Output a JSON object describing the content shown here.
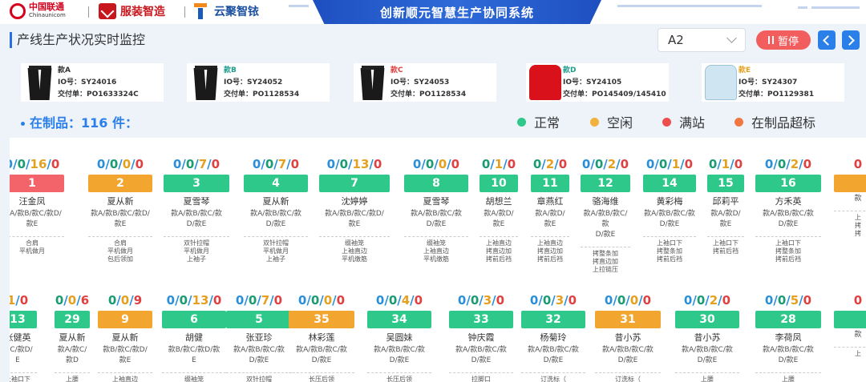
{
  "header": {
    "unicom_cn": "中国联通",
    "unicom_en": "Chinaunicom",
    "fz_name": "服装智造",
    "yj_name": "云聚智铱",
    "system_title": "创新顺元智慧生产协同系统"
  },
  "toolbar": {
    "page_title": "产线生产状况实时监控",
    "line_select_value": "A2",
    "pause_label": "暂停"
  },
  "styles": [
    {
      "name": "款A",
      "io": "IO号：SY24016",
      "order": "交付单：PO1633324C",
      "name_color": "#333333",
      "garment": "black-pants"
    },
    {
      "name": "款B",
      "io": "IO号：SY24052",
      "order": "交付单：PO1128534",
      "name_color": "#1f9c8c",
      "garment": "black-pants"
    },
    {
      "name": "款C",
      "io": "IO号：SY24053",
      "order": "交付单：PO1128534",
      "name_color": "#e04040",
      "garment": "black-pants"
    },
    {
      "name": "款D",
      "io": "IO号：SY24105",
      "order": "交付单：PO145409/145410",
      "name_color": "#1f9c8c",
      "garment": "red-hoodie"
    },
    {
      "name": "款E",
      "io": "IO号：SY24307",
      "order": "交付单：PO1129381",
      "name_color": "#e6a020",
      "garment": "blue-hoodie"
    }
  ],
  "wip_text": "在制品：116 件：",
  "legend": [
    {
      "label": "正常",
      "color": "#2ec88a"
    },
    {
      "label": "空闲",
      "color": "#f2b13a"
    },
    {
      "label": "满站",
      "color": "#ef4e4e"
    },
    {
      "label": "在制品超标",
      "color": "#f07840"
    }
  ],
  "stations_row1": [
    {
      "counts": [
        "0",
        "0",
        "16",
        "0"
      ],
      "num": "1",
      "status": "red",
      "worker": "汪金凤",
      "styles": [
        "款A/款B/款C/款D/",
        "款E"
      ],
      "ops": [
        "合肩",
        "平机做月"
      ]
    },
    {
      "counts": [
        "0",
        "0",
        "0",
        "0"
      ],
      "num": "2",
      "status": "orange",
      "worker": "夏从新",
      "styles": [
        "款A/款B/款C/款D/",
        "款E"
      ],
      "ops": [
        "合肩",
        "平机做月",
        "包后领加"
      ]
    },
    {
      "counts": [
        "0",
        "0",
        "7",
        "0"
      ],
      "num": "3",
      "status": "green",
      "worker": "夏雪琴",
      "styles": [
        "款A/款B/款C/款",
        "D/款E"
      ],
      "ops": [
        "双针拉帽",
        "平机做月",
        "上袖子"
      ]
    },
    {
      "counts": [
        "0",
        "0",
        "7",
        "0"
      ],
      "num": "4",
      "status": "green",
      "worker": "夏从新",
      "styles": [
        "款A/款B/款C/款",
        "D/款E"
      ],
      "ops": [
        "双针拉帽",
        "平机做月",
        "上袖子"
      ]
    },
    {
      "counts": [
        "0",
        "0",
        "13",
        "0"
      ],
      "num": "7",
      "status": "green",
      "worker": "沈婷婷",
      "styles": [
        "款A/款B/款C/款D/",
        "款E"
      ],
      "ops": [
        "缀袖笼",
        "上袖直边",
        "平机缴筋"
      ]
    },
    {
      "counts": [
        "0",
        "0",
        "0",
        "0"
      ],
      "num": "8",
      "status": "green",
      "worker": "夏雪琴",
      "styles": [
        "款A/款B/款C/款",
        "D/款E"
      ],
      "ops": [
        "缀袖笼",
        "上袖直边",
        "平机缴筋"
      ]
    },
    {
      "counts": [
        "0",
        "1",
        "0"
      ],
      "num": "10",
      "status": "green",
      "worker": "胡想兰",
      "styles": [
        "款A/款D/",
        "款E"
      ],
      "ops": [
        "上袖直边",
        "拷直边加",
        "拷前后裆"
      ]
    },
    {
      "counts": [
        "0",
        "2",
        "0"
      ],
      "num": "11",
      "status": "green",
      "worker": "章燕红",
      "styles": [
        "款A/款D/",
        "款E"
      ],
      "ops": [
        "上袖直边",
        "拷直边加",
        "拷前后裆"
      ]
    },
    {
      "counts": [
        "0",
        "0",
        "2",
        "0"
      ],
      "num": "12",
      "status": "green",
      "worker": "骆海维",
      "styles": [
        "款A/款B/款C/款",
        "D/款E"
      ],
      "ops": [
        "拷整条加",
        "拷直边加",
        "上拉链压"
      ]
    },
    {
      "counts": [
        "0",
        "0",
        "1",
        "0"
      ],
      "num": "14",
      "status": "green",
      "worker": "黄彩梅",
      "styles": [
        "款A/款B/款C/款",
        "D/款E"
      ],
      "ops": [
        "上袖口下",
        "拷整条加",
        "拷前后裆"
      ]
    },
    {
      "counts": [
        "0",
        "1",
        "0"
      ],
      "num": "15",
      "status": "green",
      "worker": "邱莉平",
      "styles": [
        "款A/款D/",
        "款E"
      ],
      "ops": [
        "上袖口下",
        "拷前后裆"
      ]
    },
    {
      "counts": [
        "0",
        "0",
        "2",
        "0"
      ],
      "num": "16",
      "status": "green",
      "worker": "方禾英",
      "styles": [
        "款A/款B/款C/款",
        "D/款E"
      ],
      "ops": [
        "上袖口下",
        "拷整条加",
        "拷前后裆"
      ]
    },
    {
      "counts": [
        "0"
      ],
      "num": "",
      "status": "orange",
      "worker": "",
      "styles": [
        "款"
      ],
      "ops": [
        "上",
        "拷",
        "拷"
      ]
    }
  ],
  "stations_row2": [
    {
      "counts": [
        "1",
        "0"
      ],
      "num": "13",
      "status": "green",
      "worker": "张健英",
      "styles": [
        "款C/款D/",
        "E"
      ],
      "ops": [
        "上袖口下",
        "拷整条加"
      ]
    },
    {
      "counts": [
        "0",
        "0",
        "6"
      ],
      "num": "29",
      "status": "green",
      "worker": "夏从新",
      "styles": [
        "款A/款C/",
        "款D"
      ],
      "ops": [
        "上腰",
        "上帽子"
      ]
    },
    {
      "counts": [
        "0",
        "0",
        "9"
      ],
      "num": "9",
      "status": "orange",
      "worker": "夏从新",
      "styles": [
        "款B/款C/款D/",
        "款E"
      ],
      "ops": [
        "上袖直边",
        "拷直边加"
      ]
    },
    {
      "counts": [
        "0",
        "0",
        "13",
        "0"
      ],
      "num": "6",
      "status": "green",
      "worker": "胡健",
      "styles": [
        "款B/款C/款D/款",
        "E"
      ],
      "ops": [
        "缀袖笼",
        "上袖直边"
      ]
    },
    {
      "counts": [
        "0",
        "0",
        "7",
        "0"
      ],
      "num": "5",
      "status": "green",
      "worker": "张亚珍",
      "styles": [
        "款A/款B/款C/款",
        "D/款E"
      ],
      "ops": [
        "双针拉帽",
        "平机做月"
      ]
    },
    {
      "counts": [
        "0",
        "0",
        "0",
        "0"
      ],
      "num": "35",
      "status": "orange",
      "worker": "林彩莲",
      "styles": [
        "款A/款B/款C/款",
        "D/款E"
      ],
      "ops": [
        "长压后领",
        "拉脚口"
      ]
    },
    {
      "counts": [
        "0",
        "0",
        "4",
        "0"
      ],
      "num": "34",
      "status": "green",
      "worker": "吴圆妹",
      "styles": [
        "款A/款B/款C/款",
        "D/款E"
      ],
      "ops": [
        "长压后领",
        "拉脚口"
      ]
    },
    {
      "counts": [
        "0",
        "0",
        "3",
        "0"
      ],
      "num": "33",
      "status": "green",
      "worker": "钟庆霞",
      "styles": [
        "款A/款B/款C/款",
        "D/款E"
      ],
      "ops": [
        "拉脚口",
        "订洗标（"
      ]
    },
    {
      "counts": [
        "0",
        "0",
        "3",
        "0"
      ],
      "num": "32",
      "status": "green",
      "worker": "杨菊玲",
      "styles": [
        "款A/款B/款C/款",
        "D/款E"
      ],
      "ops": [
        "订洗标（",
        "长埃后档"
      ]
    },
    {
      "counts": [
        "0",
        "0",
        "0",
        "0"
      ],
      "num": "31",
      "status": "orange",
      "worker": "昔小苏",
      "styles": [
        "款A/款B/款C/款",
        "D/款E"
      ],
      "ops": [
        "订洗标（",
        "长埃后档"
      ]
    },
    {
      "counts": [
        "0",
        "0",
        "2",
        "0"
      ],
      "num": "30",
      "status": "green",
      "worker": "昔小苏",
      "styles": [
        "款A/款B/款C/款",
        "D/款E"
      ],
      "ops": [
        "上腰",
        "订洗标（"
      ]
    },
    {
      "counts": [
        "0",
        "0",
        "5",
        "0"
      ],
      "num": "28",
      "status": "green",
      "worker": "李荷凤",
      "styles": [
        "款A/款B/款C/款",
        "D/款E"
      ],
      "ops": [
        "上腰",
        "上帽子"
      ]
    },
    {
      "counts": [
        "0"
      ],
      "num": "",
      "status": "green",
      "worker": "",
      "styles": [
        "款"
      ],
      "ops": [
        "上"
      ]
    }
  ]
}
